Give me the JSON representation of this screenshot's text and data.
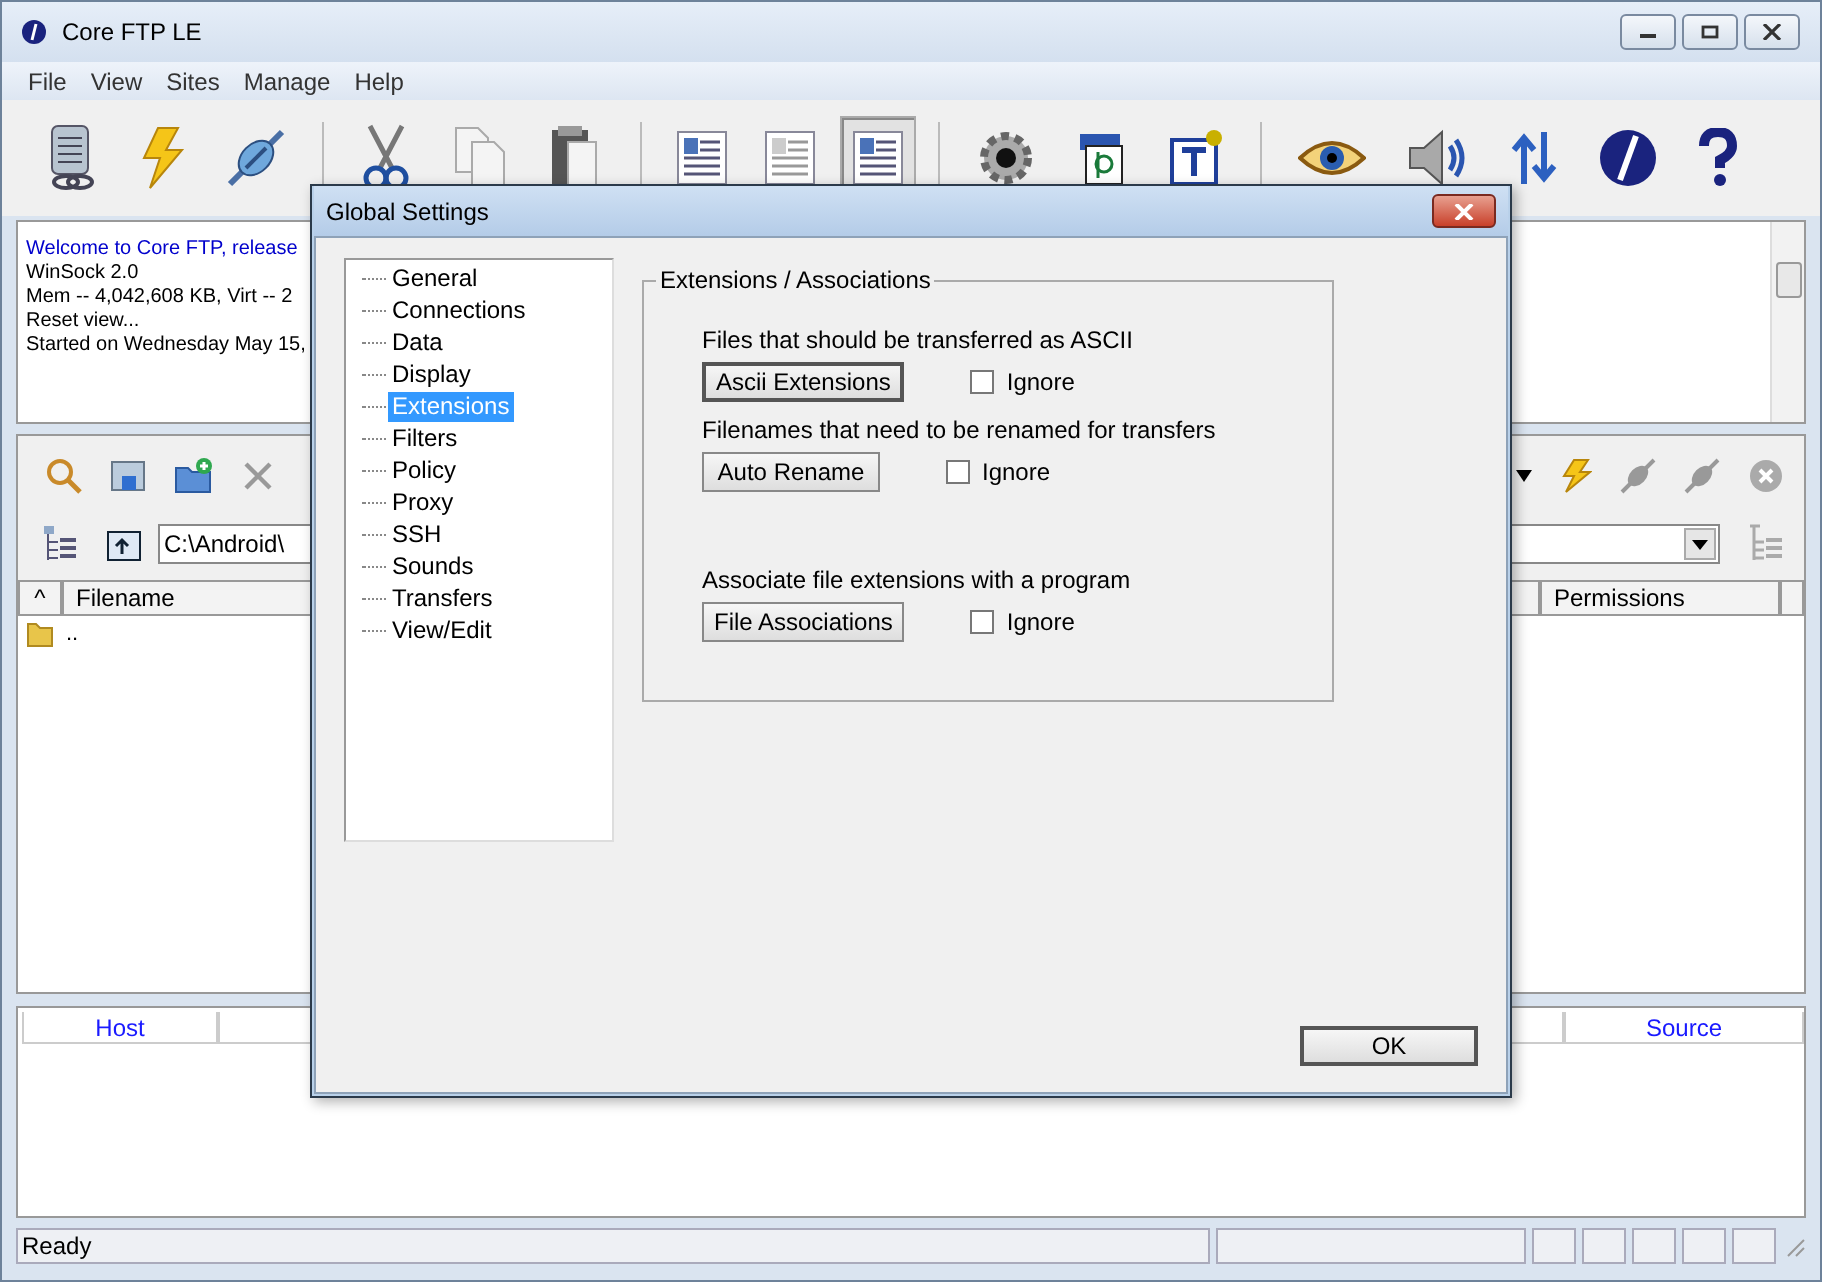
{
  "window": {
    "title": "Core FTP LE"
  },
  "menu": [
    "File",
    "View",
    "Sites",
    "Manage",
    "Help"
  ],
  "view_buttons": [
    {
      "selected": false
    },
    {
      "selected": false
    },
    {
      "selected": true
    }
  ],
  "log": [
    {
      "text": "Welcome to Core FTP, release",
      "color": "#0000cc"
    },
    {
      "text": "WinSock 2.0",
      "color": "#000000"
    },
    {
      "text": "Mem -- 4,042,608 KB, Virt -- 2",
      "color": "#000000"
    },
    {
      "text": "Reset view...",
      "color": "#000000"
    },
    {
      "text": "Started on Wednesday May 15,",
      "color": "#000000"
    }
  ],
  "local_pane": {
    "path": "C:\\Android\\",
    "columns": [
      "^",
      "Filename"
    ],
    "rows": [
      ".."
    ]
  },
  "remote_pane": {
    "columns": [
      "Permissions"
    ]
  },
  "queue": {
    "columns": [
      "Host",
      "Source"
    ]
  },
  "status_bar": {
    "text": "Ready"
  },
  "dialog": {
    "title": "Global Settings",
    "tree": [
      {
        "label": "General",
        "selected": false
      },
      {
        "label": "Connections",
        "selected": false
      },
      {
        "label": "Data",
        "selected": false
      },
      {
        "label": "Display",
        "selected": false
      },
      {
        "label": "Extensions",
        "selected": true
      },
      {
        "label": "Filters",
        "selected": false
      },
      {
        "label": "Policy",
        "selected": false
      },
      {
        "label": "Proxy",
        "selected": false
      },
      {
        "label": "SSH",
        "selected": false
      },
      {
        "label": "Sounds",
        "selected": false
      },
      {
        "label": "Transfers",
        "selected": false
      },
      {
        "label": "View/Edit",
        "selected": false
      }
    ],
    "group_title": "Extensions / Associations",
    "sections": [
      {
        "description": "Files that should be transferred as ASCII",
        "button": "Ascii Extensions",
        "default": true,
        "checkbox": "Ignore",
        "checked": false
      },
      {
        "description": "Filenames that need to be renamed for transfers",
        "button": "Auto Rename",
        "default": false,
        "checkbox": "Ignore",
        "checked": false
      },
      {
        "description": "Associate file extensions with a program",
        "button": "File Associations",
        "default": false,
        "checkbox": "Ignore",
        "checked": false
      }
    ],
    "ok": "OK"
  }
}
